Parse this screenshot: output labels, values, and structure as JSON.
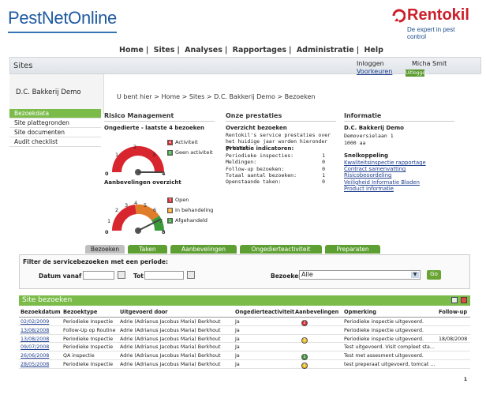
{
  "brand": {
    "logo": "PestNetOnline",
    "rentokil": "Rentokil",
    "rentokil_tagline": "De expert in pest control"
  },
  "nav": [
    "Home",
    "Sites",
    "Analyses",
    "Rapportages",
    "Administratie",
    "Help"
  ],
  "section_title": "Sites",
  "user": {
    "login_label": "Inloggen",
    "name": "Micha Smit",
    "prefs": "Voorkeuren",
    "login_button": "Uitloggen"
  },
  "client": "D.C. Bakkerij Demo",
  "breadcrumb": "U bent hier > Home > Sites > D.C. Bakkerij Demo > Bezoeken",
  "sidebar": [
    {
      "label": "Bezoekdata",
      "active": true
    },
    {
      "label": "Site plattegronden",
      "active": false
    },
    {
      "label": "Site documenten",
      "active": false
    },
    {
      "label": "Audit checklist",
      "active": false
    }
  ],
  "risk": {
    "title": "Risico Management",
    "subtitle": "Ongedierte - laatste 4 bezoeken",
    "gauge1_labels": [
      "0",
      "1",
      "2",
      "3",
      "4"
    ],
    "legend1": [
      {
        "num": "4",
        "label": "Activiteit",
        "color": "#d8262f"
      },
      {
        "num": "0",
        "label": "Geen activiteit",
        "color": "#3b9a3a"
      }
    ],
    "overview_title": "Aanbevelingen overzicht",
    "gauge2_labels": [
      "0",
      "1",
      "2",
      "3",
      "4",
      "5",
      "6",
      "7",
      "8"
    ],
    "legend2": [
      {
        "num": "3",
        "label": "Open",
        "color": "#d8262f"
      },
      {
        "num": "0",
        "label": "In behandeling",
        "color": "#f0a020"
      },
      {
        "num": "1",
        "label": "Afgehandeld",
        "color": "#3b9a3a"
      }
    ]
  },
  "performance": {
    "title": "Onze prestaties",
    "overview": "Overzicht bezoeken",
    "desc": "Rentokil's service prestaties over het huidige jaar worden hieronder getoond.",
    "indicators_title": "Prestatie indicatoren:",
    "indicators": [
      {
        "label": "Periodieke inspecties:",
        "value": "1"
      },
      {
        "label": "Meldingen:",
        "value": "0"
      },
      {
        "label": "Follow-up bezoeken:",
        "value": "0"
      },
      {
        "label": "Totaal aantal bezoeken:",
        "value": "1"
      },
      {
        "label": "Openstaande taken:",
        "value": "0"
      }
    ]
  },
  "info": {
    "title": "Informatie",
    "name": "D.C. Bakkerij Demo",
    "address1": "Demoversielaan 1",
    "address2": "1000 aa",
    "quick_title": "Snelkoppeling",
    "links": [
      "Kwaliteitsinspectie rapportage",
      "Contract samenvatting",
      "Risicobeoordeling",
      "Veiligheid Informatie Bladen",
      "Product informatie"
    ]
  },
  "tabs": [
    "Bezoeken",
    "Taken",
    "Aanbevelingen",
    "Ongedierteactiviteit",
    "Preparaten"
  ],
  "filter": {
    "title": "Filter de servicebezoeken met een periode:",
    "from_label": "Datum vanaf",
    "to_label": "Tot",
    "type_label": "Bezoeken",
    "type_value": "Alle",
    "go": "Go"
  },
  "table": {
    "title": "Site bezoeken",
    "headers": [
      "Bezoekdatum",
      "Bezoektype",
      "Uitgevoerd door",
      "Ongedierteactiviteit",
      "Aanbevelingen",
      "Opmerking",
      "Follow-up"
    ],
    "rows": [
      {
        "date": "02/02/2009",
        "type": "Periodieke Inspectie",
        "by": "Adrie (Adrianus Jacobus Maria) Berkhout",
        "act": "Ja",
        "rec": [
          {
            "n": "2",
            "c": "#d8262f"
          }
        ],
        "note": "Periodieke inspectie uitgevoerd.",
        "follow": ""
      },
      {
        "date": "13/08/2008",
        "type": "Follow-Up op Routine",
        "by": "Adrie (Adrianus Jacobus Maria) Berkhout",
        "act": "Ja",
        "rec": [],
        "note": "Periodieke inspectie uitgevoerd.",
        "follow": ""
      },
      {
        "date": "13/08/2008",
        "type": "Periodieke Inspectie",
        "by": "Adrie (Adrianus Jacobus Maria) Berkhout",
        "act": "Ja",
        "rec": [
          {
            "n": "2",
            "c": "#f0c020"
          }
        ],
        "note": "Periodieke inspectie uitgevoerd.",
        "follow": "18/08/2008"
      },
      {
        "date": "09/07/2008",
        "type": "Periodieke Inspectie",
        "by": "Adrie (Adrianus Jacobus Maria) Berkhout",
        "act": "Ja",
        "rec": [],
        "note": "Test uitgevoerd. Visit compleet sta...",
        "follow": ""
      },
      {
        "date": "26/06/2008",
        "type": "QA inspectie",
        "by": "Adrie (Adrianus Jacobus Maria) Berkhout",
        "act": "Ja",
        "rec": [
          {
            "n": "1",
            "c": "#f0c020"
          },
          {
            "n": "1",
            "c": "#3b9a3a"
          }
        ],
        "note": "Test met assesment uitgevoerd.",
        "follow": ""
      },
      {
        "date": "28/05/2008",
        "type": "Periodieke Inspectie",
        "by": "Adrie (Adrianus Jacobus Maria) Berkhout",
        "act": "Ja",
        "rec": [
          {
            "n": "1",
            "c": "#d8262f"
          },
          {
            "n": "1",
            "c": "#f0c020"
          }
        ],
        "note": "test preperaat uitgevoerd, tomcat ...",
        "follow": ""
      }
    ],
    "page": "1"
  }
}
